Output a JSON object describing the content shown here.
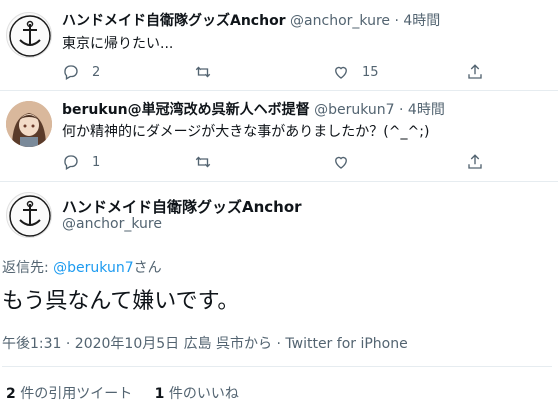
{
  "tweets": [
    {
      "name": "ハンドメイド自衛隊グッズAnchor",
      "handle": "@anchor_kure",
      "dot": "·",
      "time": "4時間",
      "text": "東京に帰りたい...",
      "replies": "2",
      "retweets": "",
      "likes": "15"
    },
    {
      "name": "berukun@単冠湾改め呉新人ヘボ提督",
      "handle": "@berukun7",
      "dot": "·",
      "time": "4時間",
      "text": "何か精神的にダメージが大きな事がありましたか？(^_^;)",
      "replies": "1",
      "retweets": "",
      "likes": ""
    }
  ],
  "focal": {
    "name": "ハンドメイド自衛隊グッズAnchor",
    "handle": "@anchor_kure",
    "avatar_text": "ANCHOR",
    "reply_prefix": "返信先: ",
    "reply_link": "@berukun7",
    "reply_suffix": "さん",
    "text": "もう呉なんて嫌いです。",
    "meta": "午後1:31 · 2020年10月5日 広島 呉市から · Twitter for iPhone",
    "quote_count": "2",
    "quote_label": " 件の引用ツイート",
    "like_count": "1",
    "like_label": " 件のいいね"
  },
  "icons": {
    "reply": "reply-icon",
    "retweet": "retweet-icon",
    "like": "heart-icon",
    "share": "share-icon"
  },
  "colors": {
    "link": "#1d9bf0",
    "secondary_text": "#536471",
    "divider": "#e6ecf0"
  }
}
